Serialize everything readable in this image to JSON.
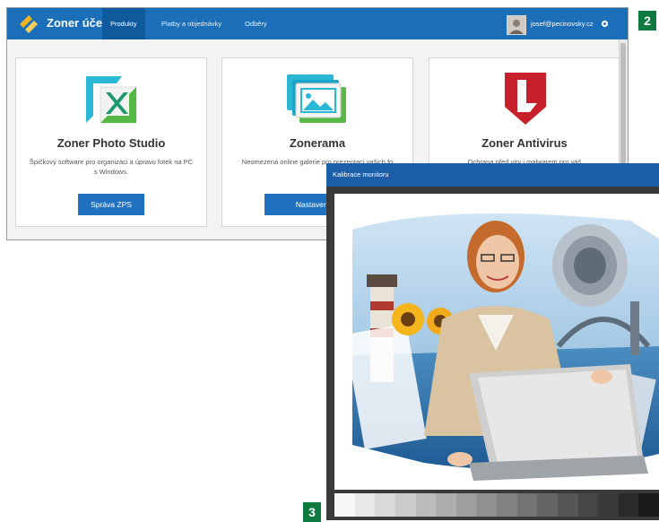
{
  "zoner_window": {
    "badge": "2",
    "brand": "Zoner účet",
    "nav": [
      {
        "label": "Produkty"
      },
      {
        "label": "Platby a objednávky"
      },
      {
        "label": "Odběry"
      }
    ],
    "user_email": "josef@pecinovsky.cz",
    "cards": [
      {
        "title": "Zoner Photo Studio",
        "description": "Špičkový software pro organizaci a úpravu fotek na PC s Windows.",
        "button": "Správa ZPS",
        "icon": "zoner-photo-studio-icon"
      },
      {
        "title": "Zonerama",
        "description": "Neomezená online galerie pro prezentaci vašich fo",
        "button": "Nastavení Zo",
        "icon": "zonerama-icon"
      },
      {
        "title": "Zoner Antivirus",
        "description": "Ochrana před viry i malwarem pro váš",
        "button": "",
        "icon": "zoner-antivirus-icon"
      }
    ],
    "colors": {
      "topbar": "#1a6fb8",
      "button": "#1f72bf",
      "badge": "#0e7a3f"
    }
  },
  "calibration_window": {
    "badge": "3",
    "title": "Kalibrace monitoru",
    "test_image": "woman-with-laptop-calibration-image",
    "gray_ramp": [
      "#f7f7f7",
      "#e8e8e8",
      "#d9d9d9",
      "#cbcbcb",
      "#bcbcbc",
      "#aeaeae",
      "#9f9f9f",
      "#909090",
      "#828282",
      "#737373",
      "#646464",
      "#565656",
      "#474747",
      "#393939",
      "#2a2a2a",
      "#1b1b1b"
    ]
  }
}
